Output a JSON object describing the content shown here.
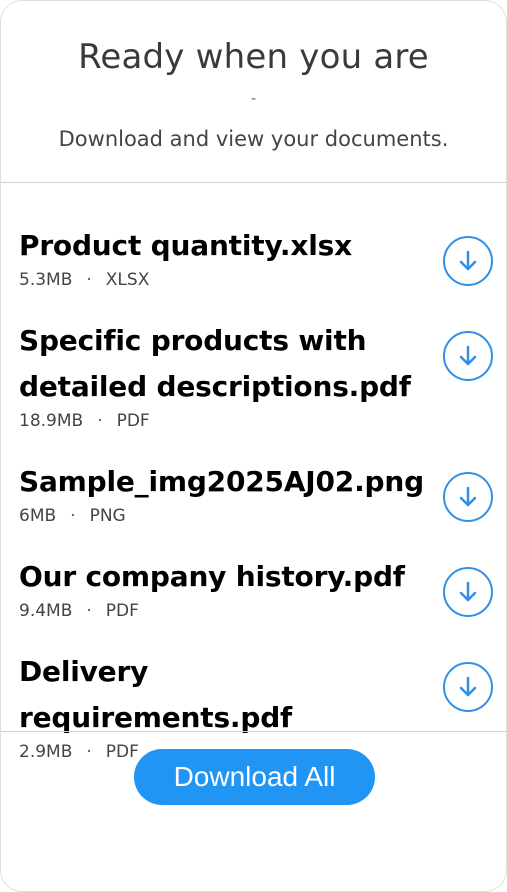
{
  "header": {
    "title": "Ready when you are",
    "dash": "-",
    "subtitle": "Download and view your documents."
  },
  "files": [
    {
      "name": "Product quantity.xlsx",
      "size": "5.3MB",
      "separator": "·",
      "type": "XLSX"
    },
    {
      "name": "Specific products with detailed descriptions.pdf",
      "size": "18.9MB",
      "separator": "·",
      "type": "PDF"
    },
    {
      "name": "Sample_img2025AJ02.png",
      "size": "6MB",
      "separator": "·",
      "type": "PNG"
    },
    {
      "name": "Our company history.pdf",
      "size": "9.4MB",
      "separator": "·",
      "type": "PDF"
    },
    {
      "name": "Delivery requirements.pdf",
      "size": "2.9MB",
      "separator": "·",
      "type": "PDF"
    }
  ],
  "download_all_label": "Download All",
  "colors": {
    "accent": "#2195f3",
    "icon_stroke": "#2f90e6"
  },
  "icons": {
    "file_action": "download-arrow-icon"
  }
}
